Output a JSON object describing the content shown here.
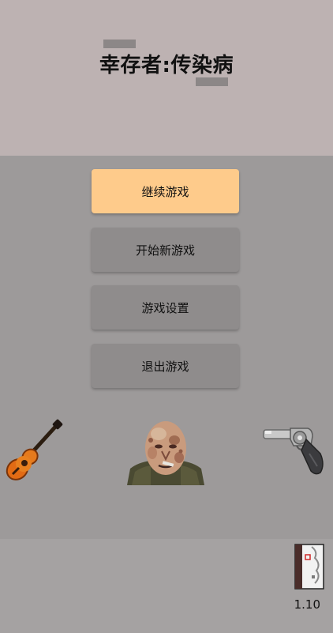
{
  "game": {
    "title": "幸存者:传染病",
    "version": "1.10"
  },
  "menu": {
    "items": [
      {
        "label": "继续游戏",
        "primary": true
      },
      {
        "label": "开始新游戏",
        "primary": false
      },
      {
        "label": "游戏设置",
        "primary": false
      },
      {
        "label": "退出游戏",
        "primary": false
      }
    ]
  },
  "icons": {
    "left": "guitar-icon",
    "center": "zombie-portrait",
    "right": "revolver-icon",
    "corner": "journal-book-icon"
  },
  "colors": {
    "header_bg": "#bdb2b2",
    "main_bg": "#9d9a9a",
    "button_bg": "#8f8c8c",
    "button_primary_bg": "#fecb8b"
  }
}
